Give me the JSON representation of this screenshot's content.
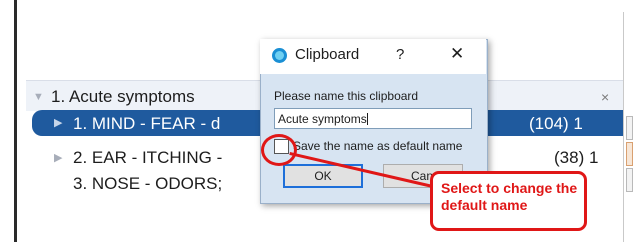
{
  "list": {
    "header": "1. Acute symptoms",
    "close_glyph": "×",
    "rows": [
      {
        "label": "1. MIND - FEAR - d",
        "count": "(104) 1"
      },
      {
        "label": "2. EAR - ITCHING -",
        "count": "(38) 1"
      },
      {
        "label": "3. NOSE - ODORS;",
        "count": ""
      }
    ]
  },
  "dialog": {
    "title": "Clipboard",
    "help": "?",
    "close": "✕",
    "prompt": "Please name this clipboard",
    "input_value": "Acute symptoms",
    "checkbox_label": "Save the name as default name",
    "checkbox_checked": false,
    "ok": "OK",
    "cancel": "Can"
  },
  "callout": {
    "text": "Select to change the default name",
    "color": "#e01717"
  },
  "colors": {
    "selection": "#1f5a9e",
    "header_bg": "#eef2f8",
    "dialog_bg": "#d7e4f2"
  }
}
